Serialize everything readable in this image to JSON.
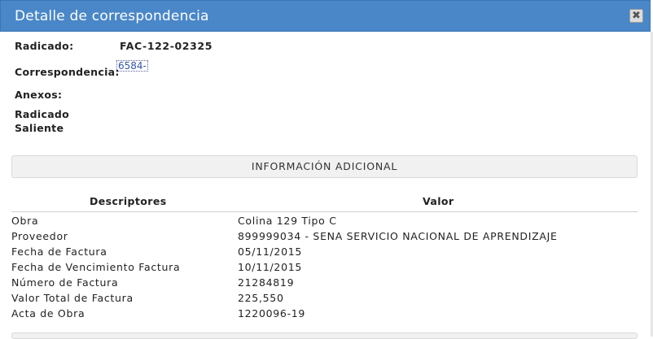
{
  "dialog": {
    "title": "Detalle de correspondencia",
    "close_glyph": "✖"
  },
  "fields": {
    "radicado_label": "Radicado:",
    "radicado_value": "FAC-122-02325",
    "correspondencia_label": "Correspondencia:",
    "correspondencia_link": "6584-",
    "anexos_label": "Anexos:",
    "radicado_saliente_label_line1": "Radicado",
    "radicado_saliente_label_line2": "Saliente"
  },
  "section": {
    "title": "INFORMACIÓN ADICIONAL"
  },
  "table": {
    "headers": [
      "Descriptores",
      "Valor"
    ],
    "rows": [
      [
        "Obra",
        "Colina 129 Tipo C"
      ],
      [
        "Proveedor",
        "899999034 - SENA SERVICIO NACIONAL DE APRENDIZAJE"
      ],
      [
        "Fecha de Factura",
        "05/11/2015"
      ],
      [
        "Fecha de Vencimiento Factura",
        "10/11/2015"
      ],
      [
        "Número de Factura",
        "21284819"
      ],
      [
        "Valor Total de Factura",
        "225,550"
      ],
      [
        "Acta de Obra",
        "1220096-19"
      ]
    ]
  }
}
